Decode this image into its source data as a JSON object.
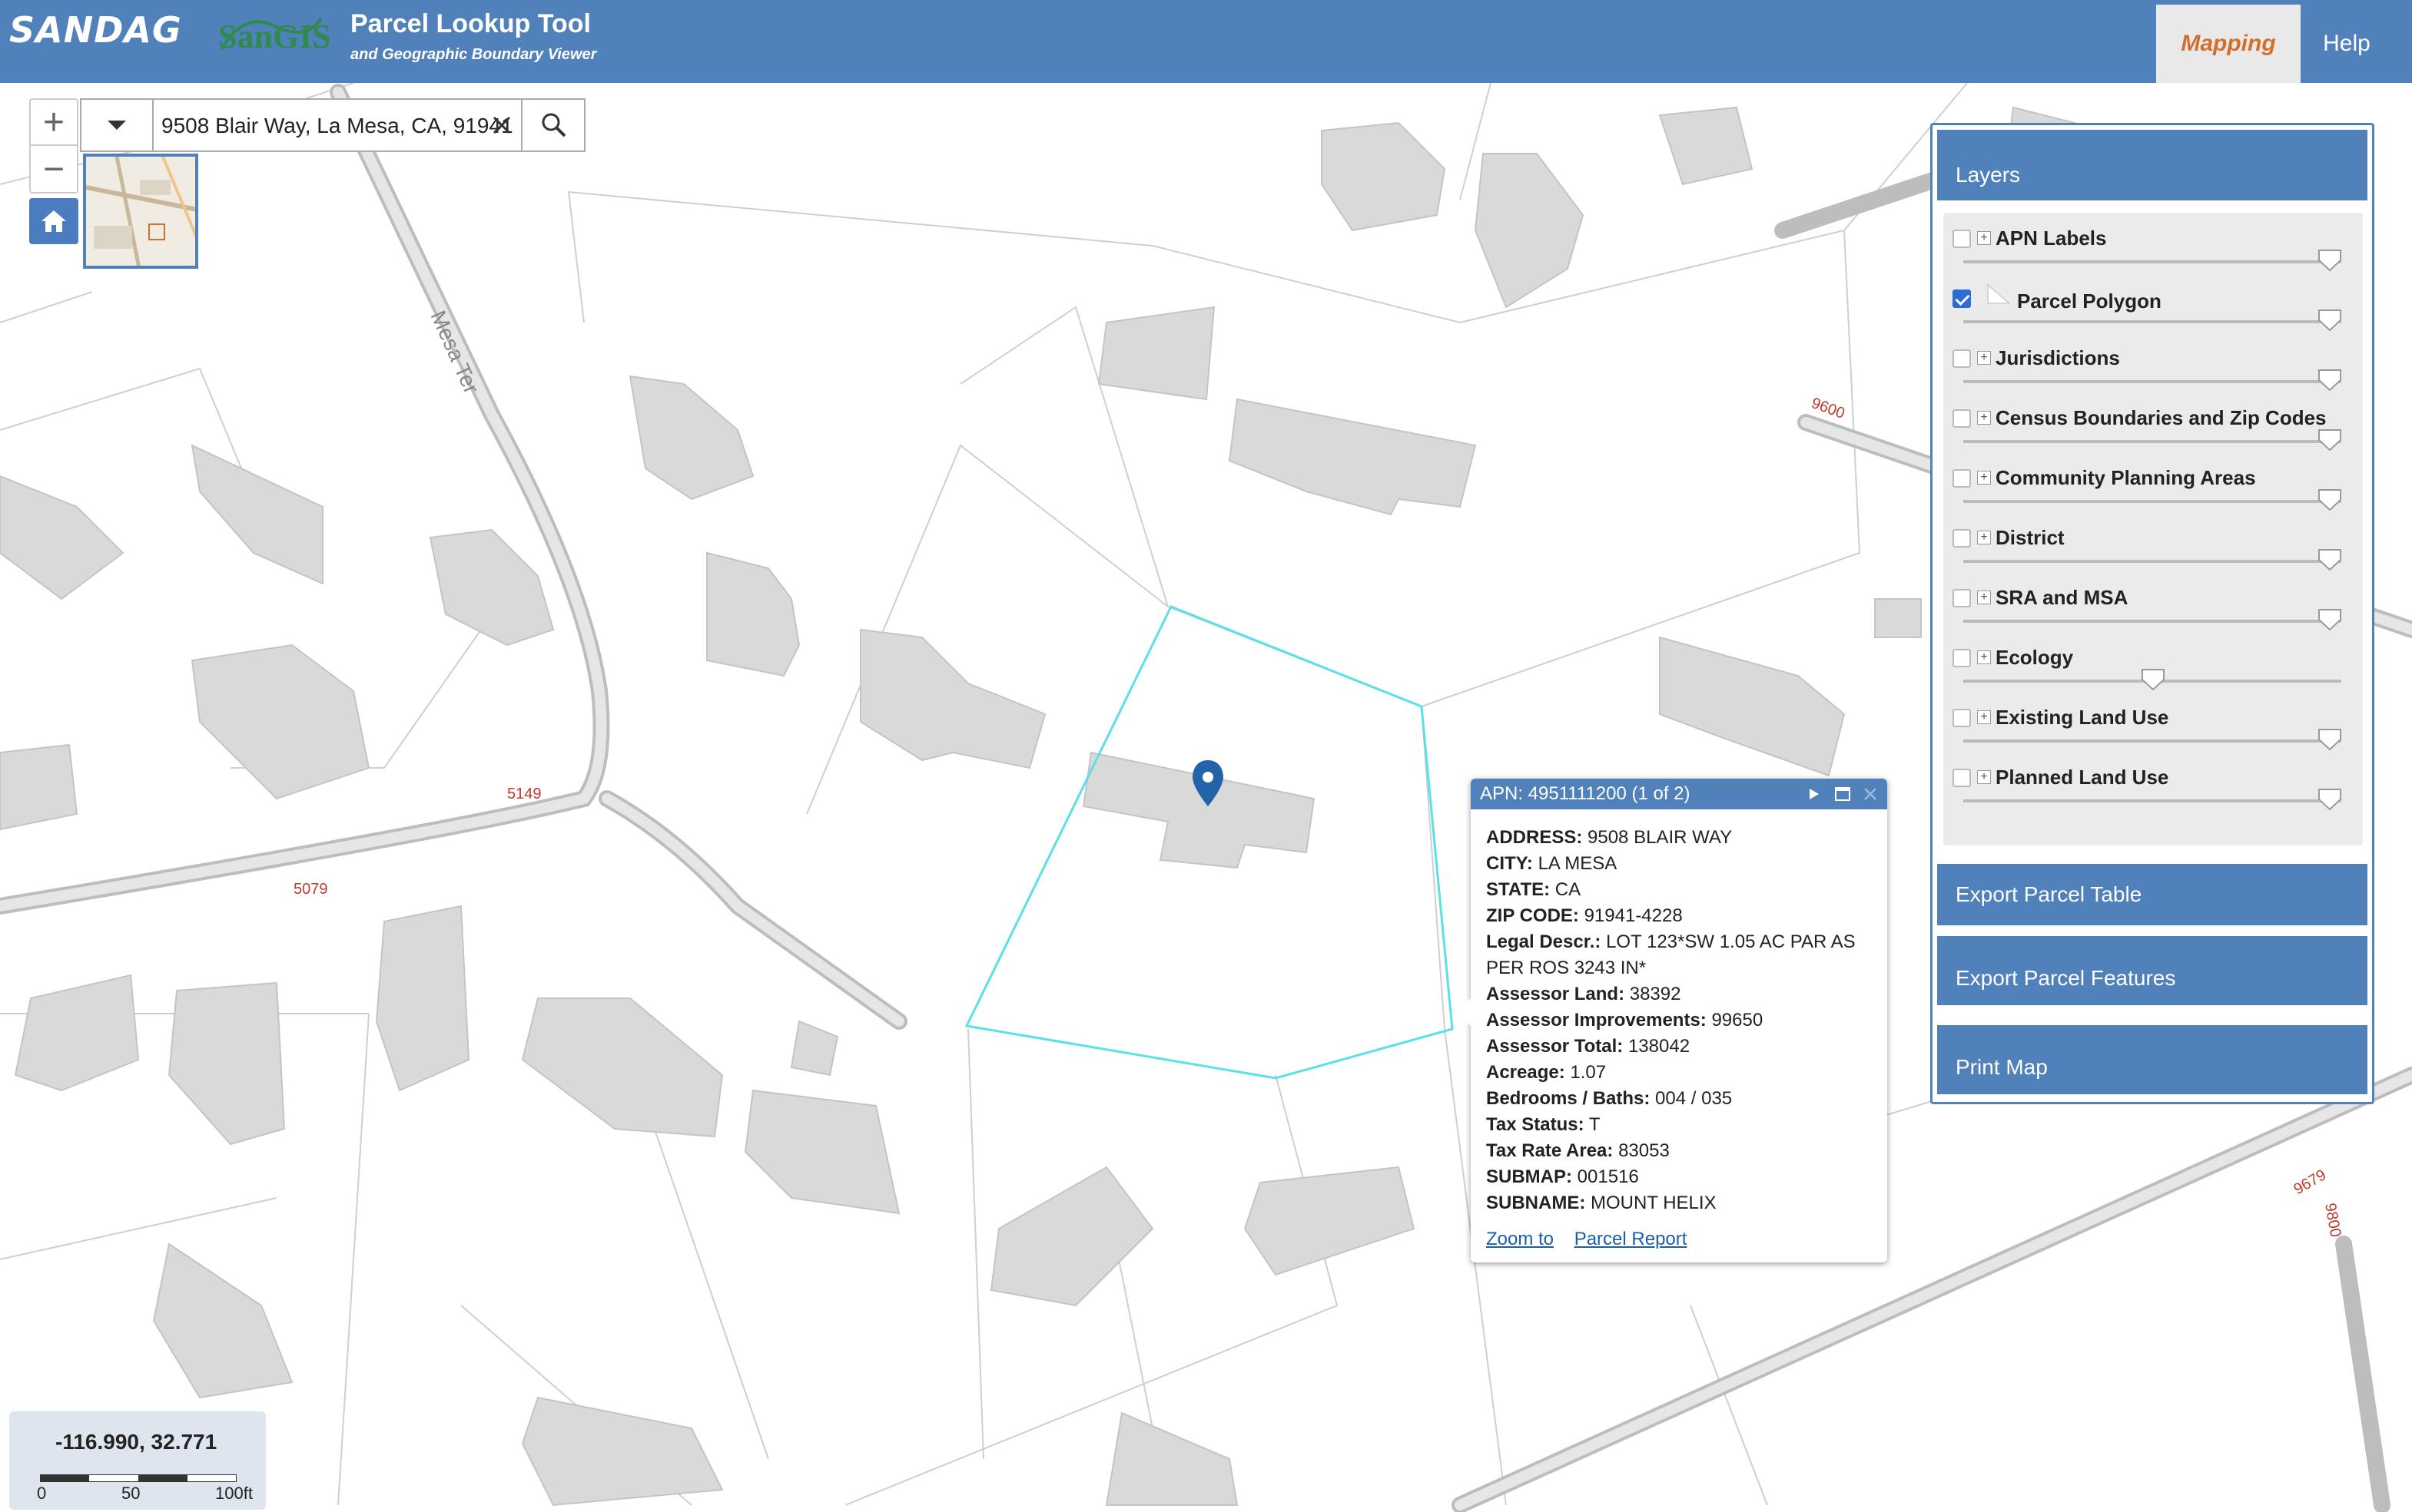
{
  "header": {
    "logo_text": "SANDAG",
    "logo_secondary": "SanGIS",
    "title": "Parcel Lookup Tool",
    "subtitle": "and Geographic Boundary Viewer",
    "tabs": [
      {
        "label": "Mapping",
        "active": true
      },
      {
        "label": "Help",
        "active": false
      }
    ],
    "colors": {
      "header_bg": "#5181ba",
      "active_tab_text": "#d0702a"
    }
  },
  "search": {
    "value": "9508 Blair Way, La Mesa, CA, 91941",
    "dropdown_icon": "chevron-down-icon",
    "clear_icon": "close-icon",
    "search_icon": "search-icon"
  },
  "map_controls": {
    "zoom_in": "+",
    "zoom_out": "−",
    "home_icon": "home-icon"
  },
  "map_labels": {
    "street_mesa_ter": "Mesa Ter",
    "numbers": [
      "5149",
      "5079",
      "9600",
      "9679",
      "9800"
    ]
  },
  "layers_panel": {
    "title": "Layers",
    "layers": [
      {
        "label": "APN Labels",
        "checked": false,
        "opacity": 0.97
      },
      {
        "label": "Parcel Polygon",
        "checked": true,
        "opacity": 0.97
      },
      {
        "label": "Jurisdictions",
        "checked": false,
        "opacity": 0.97
      },
      {
        "label": "Census Boundaries and Zip Codes",
        "checked": false,
        "opacity": 0.97
      },
      {
        "label": "Community Planning Areas",
        "checked": false,
        "opacity": 0.97
      },
      {
        "label": "District",
        "checked": false,
        "opacity": 0.97
      },
      {
        "label": "SRA and MSA",
        "checked": false,
        "opacity": 0.97
      },
      {
        "label": "Ecology",
        "checked": false,
        "opacity": 0.5
      },
      {
        "label": "Existing Land Use",
        "checked": false,
        "opacity": 0.97
      },
      {
        "label": "Planned Land Use",
        "checked": false,
        "opacity": 0.97
      }
    ],
    "buttons": {
      "export_table": "Export Parcel Table",
      "export_features": "Export Parcel Features",
      "print_map": "Print Map"
    }
  },
  "popup": {
    "title": "APN: 4951111200 (1 of 2)",
    "fields": [
      {
        "label": "ADDRESS:",
        "value": "9508 BLAIR WAY"
      },
      {
        "label": "CITY:",
        "value": "LA MESA"
      },
      {
        "label": "STATE:",
        "value": "CA"
      },
      {
        "label": "ZIP CODE:",
        "value": "91941-4228"
      },
      {
        "label": "Legal Descr.:",
        "value": "LOT 123*SW 1.05 AC PAR AS PER ROS 3243 IN*"
      },
      {
        "label": "Assessor Land:",
        "value": "38392"
      },
      {
        "label": "Assessor Improvements:",
        "value": "99650"
      },
      {
        "label": "Assessor Total:",
        "value": "138042"
      },
      {
        "label": "Acreage:",
        "value": "1.07"
      },
      {
        "label": "Bedrooms / Baths:",
        "value": "004 / 035"
      },
      {
        "label": "Tax Status:",
        "value": "T"
      },
      {
        "label": "Tax Rate Area:",
        "value": "83053"
      },
      {
        "label": "SUBMAP:",
        "value": "001516"
      },
      {
        "label": "SUBNAME:",
        "value": "MOUNT HELIX"
      }
    ],
    "links": {
      "zoom_to": "Zoom to",
      "parcel_report": "Parcel Report"
    }
  },
  "coords": {
    "text": "-116.990, 32.771",
    "scale_labels": [
      "0",
      "50",
      "100ft"
    ]
  }
}
